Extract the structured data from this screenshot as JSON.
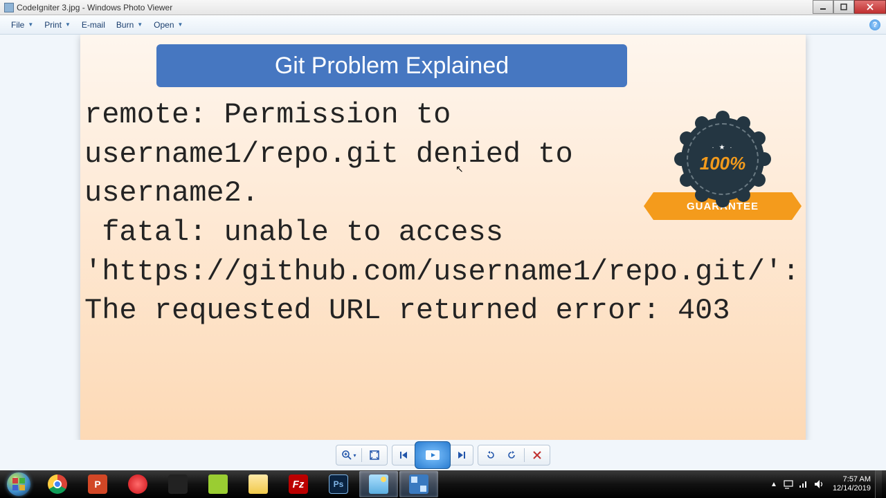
{
  "titlebar": {
    "title": "CodeIgniter 3.jpg - Windows Photo Viewer"
  },
  "menu": {
    "file": "File",
    "print": "Print",
    "email": "E-mail",
    "burn": "Burn",
    "open": "Open"
  },
  "photo": {
    "banner": "Git Problem Explained",
    "error_text": "remote: Permission to username1/repo.git denied to username2.\n fatal: unable to access 'https://github.com/username1/repo.git/': The requested URL returned error: 403",
    "badge_percent": "100%",
    "badge_word": "GUARANTEE"
  },
  "viewer_controls": {
    "zoom": "zoom",
    "fit": "fit",
    "prev": "previous",
    "play": "play",
    "next": "next",
    "rotate_ccw": "rotate-left",
    "rotate_cw": "rotate-right",
    "delete": "delete"
  },
  "tray": {
    "time": "7:57 AM",
    "date": "12/14/2019"
  },
  "icons": {
    "chrome": "chrome-icon",
    "powerpoint": "powerpoint-icon",
    "opera": "opera-icon",
    "nbc": "nbc-icon",
    "notepadpp": "notepadpp-icon",
    "explorer": "explorer-icon",
    "filezilla": "filezilla-icon",
    "photoshop": "photoshop-icon",
    "photoviewer": "photoviewer-icon",
    "remote": "switcher-icon"
  }
}
